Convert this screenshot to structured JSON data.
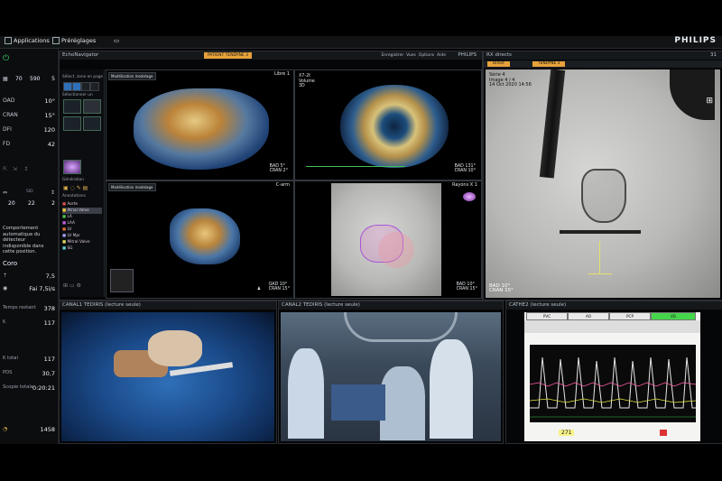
{
  "topbar": {
    "applications": "Applications",
    "preferences": "Préréglages",
    "brand": "PHILIPS"
  },
  "left": {
    "row1": [
      "70",
      "590",
      "5"
    ],
    "oad_label": "OAD",
    "oad": "10°",
    "cran_label": "CRAN",
    "cran": "15°",
    "dfi_label": "DFI",
    "dfi": "120",
    "fd_label": "FD",
    "fd": "42",
    "row2": [
      "20",
      "22",
      "2"
    ],
    "message": "Comportement automatique du détecteur indisponible dans cette position.",
    "coro": "Coro",
    "c1": "7,5",
    "fai": "Fai 7,5i/s",
    "temps_label": "Temps restant",
    "temps": "378",
    "k_label": "K",
    "k": "117",
    "ktotal_label": "K total",
    "ktotal": "117",
    "pds_label": "PDS",
    "pds": "30,7",
    "scopie_label": "Scopie totale",
    "scopie": "0:20:21",
    "bottom": "1458"
  },
  "echo": {
    "header": "EchoNavigator",
    "banner": "PATIENT TENDYNE 3",
    "panel_libre": "Libre 1",
    "panel_carm": "C-arm",
    "panel_rayons": "Rayons X 1",
    "oad_carm": "OAD 10°",
    "cran_carm": "CRAN 15°",
    "tools": {
      "reglages": "Sélect. zone en page",
      "selection": "Sélectionner un",
      "annotations": "Annotations",
      "generation": "Génération"
    },
    "annot_items": [
      "Aorte",
      "Atrial Valve",
      "LA",
      "LAA",
      "LV",
      "LV Mpr",
      "Mitral Valve",
      "SG"
    ],
    "menu": [
      "Enregistrer",
      "Vues",
      "Options",
      "Aide"
    ],
    "btn_model": "Modélisation modelage",
    "btn_model2": "Modélisation modelage",
    "brand": "PHILIPS",
    "rayons_label": "Rayons 1"
  },
  "rx": {
    "header": "RX directs",
    "tab1": "Direct",
    "tab2": "TENDYNE 3",
    "series": "Série 4",
    "image": "Image 4 / 4",
    "date": "14 Oct 2020 14:56",
    "oad": "BAD 10°",
    "cran": "CRAN 15°",
    "count": "31"
  },
  "feeds": [
    {
      "title": "CANAL1 TEDIRIS (lecture seule)"
    },
    {
      "title": "CANAL2 TEDIRIS (lecture seule)"
    },
    {
      "title": "CATHE2 (lecture seule)"
    }
  ],
  "hemo": {
    "tabs": [
      "PVC",
      "AO",
      "PCP",
      "VG"
    ],
    "bottom_value": "271"
  },
  "page_count": "11"
}
